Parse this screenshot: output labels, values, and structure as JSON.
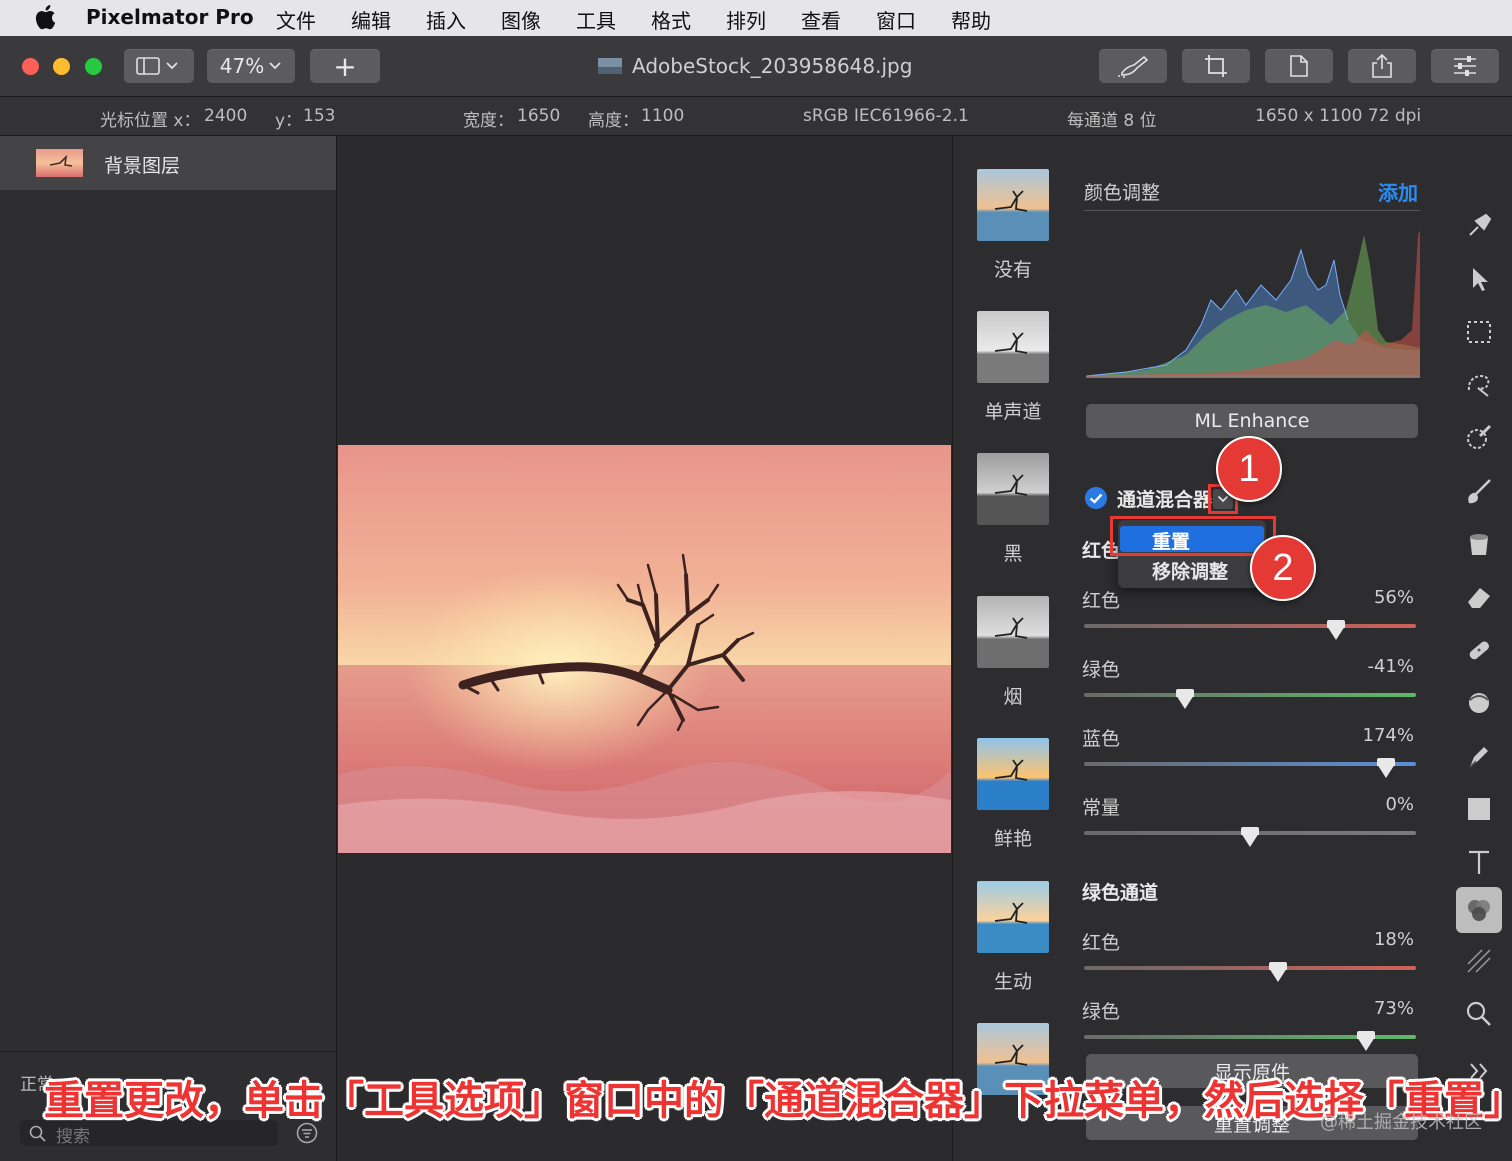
{
  "menubar": {
    "app_name": "Pixelmator Pro",
    "items": [
      "文件",
      "编辑",
      "插入",
      "图像",
      "工具",
      "格式",
      "排列",
      "查看",
      "窗口",
      "帮助"
    ]
  },
  "toolbar": {
    "zoom": "47%",
    "add_label": "+",
    "document_title": "AdobeStock_203958648.jpg"
  },
  "infobar": {
    "cursor_x_label": "光标位置 x：",
    "cursor_x": "2400",
    "cursor_y_label": "y：",
    "cursor_y": "153",
    "width_label": "宽度：",
    "width": "1650",
    "height_label": "高度：",
    "height": "1100",
    "color_profile": "sRGB IEC61966-2.1",
    "bit_depth": "每通道 8 位",
    "resolution": "1650 x 1100 72 dpi"
  },
  "layers": {
    "items": [
      {
        "name": "背景图层"
      }
    ],
    "blend_mode_partial": "正常",
    "search_placeholder": "搜索"
  },
  "presets": [
    {
      "label": "没有",
      "style": "natural"
    },
    {
      "label": "单声道",
      "style": "mono"
    },
    {
      "label": "黑",
      "style": "black"
    },
    {
      "label": "烟",
      "style": "smoke"
    },
    {
      "label": "鲜艳",
      "style": "vivid"
    },
    {
      "label": "生动",
      "style": "lively"
    },
    {
      "label": "",
      "style": "natural"
    }
  ],
  "adjustments": {
    "header": "颜色调整",
    "add_label": "添加",
    "ml_enhance": "ML Enhance",
    "channel_mixer_label": "通道混合器",
    "red_channel_partial": "红色",
    "dropdown_menu": {
      "reset": "重置",
      "remove": "移除调整"
    },
    "red_channel_sliders": [
      {
        "label": "红色",
        "value": "56%",
        "fraction": 0.76,
        "color": "#d0605a"
      },
      {
        "label": "绿色",
        "value": "-41%",
        "fraction": 0.305,
        "color": "#5fb86a"
      },
      {
        "label": "蓝色",
        "value": "174%",
        "fraction": 0.91,
        "color": "#5a8fd8"
      },
      {
        "label": "常量",
        "value": "0%",
        "fraction": 0.5,
        "color": "#7a7a7a"
      }
    ],
    "green_channel_header": "绿色通道",
    "green_channel_sliders": [
      {
        "label": "红色",
        "value": "18%",
        "fraction": 0.585,
        "color": "#d0605a"
      },
      {
        "label": "绿色",
        "value": "73%",
        "fraction": 0.85,
        "color": "#5fb86a"
      }
    ],
    "show_original": "显示原件",
    "reset_adjustments": "重置调整"
  },
  "callouts": {
    "step1": "1",
    "step2": "2"
  },
  "caption": "重置更改，单击「工具选项」窗口中的「通道混合器」下拉菜单，然后选择「重置」",
  "watermark": "@稀土掘金技术社区",
  "colors": {
    "accent_blue": "#2b7be5",
    "menu_highlight": "#1f6fe0",
    "callout_red": "#e53935",
    "caption_red": "#e33333"
  }
}
